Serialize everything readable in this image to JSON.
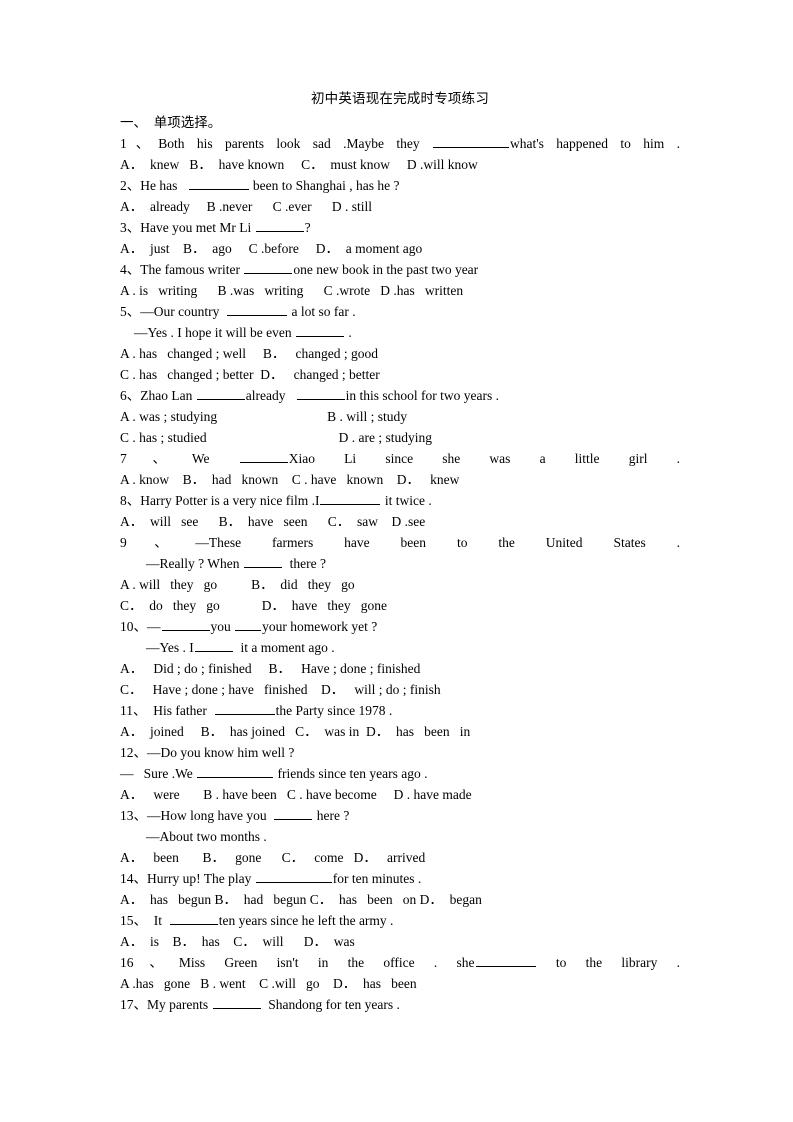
{
  "document": {
    "title": "初中英语现在完成时专项练习",
    "section_heading": "一、  单项选择。"
  },
  "questions": [
    {
      "number": "1、",
      "stem_parts": [
        "Both his parents look sad .Maybe they",
        "what's happened to him ."
      ],
      "options_lines": [
        "A．  knew   B．  have known     C．  must know     D .will know"
      ]
    },
    {
      "number": "2、",
      "stem_parts": [
        "He has",
        "been to Shanghai , has he ?"
      ],
      "options_lines": [
        "A．  already     B .never      C .ever      D . still"
      ]
    },
    {
      "number": "3、",
      "stem_parts": [
        "Have you met Mr Li",
        "?"
      ],
      "options_lines": [
        "A．  just    B．  ago     C .before     D．  a moment ago"
      ]
    },
    {
      "number": "4、",
      "stem_parts": [
        "The famous writer",
        "one new book in the past two year"
      ],
      "options_lines": [
        "A . is   writing      B .was   writing      C .wrote   D .has   written"
      ]
    },
    {
      "number": "5、",
      "stem_dash": "—Our country",
      "stem_after": "a lot so far .",
      "reply_before": "—Yes . I hope it will be even",
      "reply_after": ".",
      "options_lines": [
        "A . has   changed ; well     B．   changed ; good",
        "C . has   changed ; better  D．   changed ; better"
      ]
    },
    {
      "number": "6、",
      "stem_parts": [
        "Zhao Lan",
        "already",
        "in this school for two years ."
      ],
      "options_two_col": [
        {
          "left": "A . was ; studying",
          "right": "B . will ; study"
        },
        {
          "left": "C . has ; studied",
          "right": "D . are ; studying"
        }
      ]
    },
    {
      "number": "7、",
      "stem_parts": [
        "We",
        "Xiao Li since she was a little girl ."
      ],
      "options_lines": [
        "A . know    B．  had   known    C . have   known    D．   knew"
      ]
    },
    {
      "number": "8、",
      "stem_parts": [
        "Harry Potter is a very nice film .I",
        "it twice ."
      ],
      "options_lines": [
        "A．  will   see      B．  have   seen      C．  saw    D .see"
      ]
    },
    {
      "number": "9、",
      "stem_line": "—These farmers have been to the United States .",
      "reply_before": "—Really ? When",
      "reply_after": "there ?",
      "options_two_col": [
        {
          "left": "A . will   they   go",
          "right": "B．  did   they   go"
        },
        {
          "left": "C．  do   they   go",
          "right": "D．  have   they   gone"
        }
      ]
    },
    {
      "number": "10、",
      "stem_prefix": "—",
      "stem_mid": "you",
      "stem_after": "your homework yet ?",
      "reply_before": "—Yes . I",
      "reply_after": "it a moment ago .",
      "options_lines": [
        "A．   Did ; do ; finished     B．   Have ; done ; finished",
        "C．   Have ; done ; have   finished    D．   will ; do ; finish"
      ]
    },
    {
      "number": "11、",
      "stem_parts": [
        "His father",
        "the Party since 1978 ."
      ],
      "options_lines": [
        "A．  joined     B．  has joined   C．  was in  D．  has   been   in"
      ]
    },
    {
      "number": "12、",
      "stem_line": "—Do you know him well ?",
      "reply_dash": "—",
      "reply_before": "Sure .We",
      "reply_after": "friends since ten years ago .",
      "options_lines": [
        "A．   were       B . have been   C . have become     D . have made"
      ]
    },
    {
      "number": "13、",
      "stem_before": "—How long have you",
      "stem_after": "here ?",
      "reply_line": "—About two months .",
      "options_lines": [
        "A．   been       B．   gone      C．   come   D．   arrived"
      ]
    },
    {
      "number": "14、",
      "stem_parts": [
        "Hurry up! The play",
        "for ten minutes ."
      ],
      "options_lines": [
        "A．  has   begun B．  had   begun C．  has   been   on D．  began"
      ]
    },
    {
      "number": "15、",
      "stem_parts": [
        "It",
        "ten years since he left the army ."
      ],
      "options_lines": [
        "A．  is    B．  has    C．  will      D．  was"
      ]
    },
    {
      "number": "16、",
      "stem_parts": [
        "Miss Green isn't in the office . she",
        "to the library ."
      ],
      "options_lines": [
        "A .has   gone   B . went    C .will   go    D．  has   been"
      ]
    },
    {
      "number": "17、",
      "stem_parts": [
        "My parents",
        "Shandong for ten years ."
      ],
      "options_lines": []
    }
  ]
}
